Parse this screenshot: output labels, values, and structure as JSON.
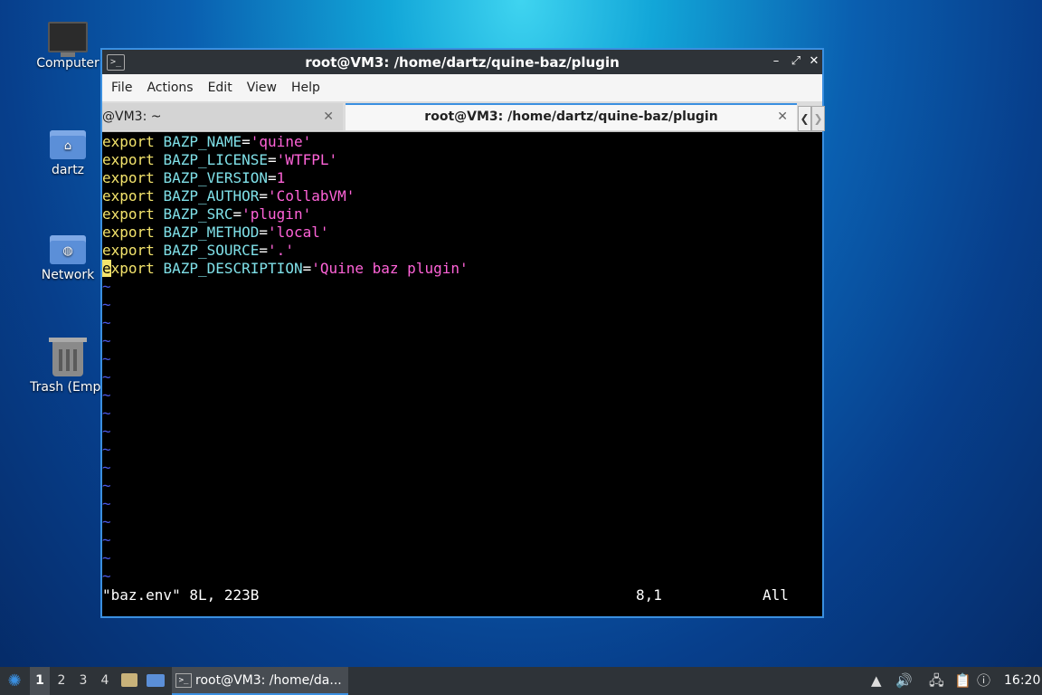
{
  "desktop": {
    "icons": [
      {
        "label": "Computer",
        "icon": "computer-icon"
      },
      {
        "label": "dartz",
        "icon": "home-folder-icon"
      },
      {
        "label": "Network",
        "icon": "network-folder-icon"
      },
      {
        "label": "Trash (Empt",
        "icon": "trash-icon"
      }
    ]
  },
  "window": {
    "title": "root@VM3: /home/dartz/quine-baz/plugin",
    "menu": [
      "File",
      "Actions",
      "Edit",
      "View",
      "Help"
    ],
    "tabs": [
      {
        "label": "@VM3: ~"
      },
      {
        "label": "root@VM3: /home/dartz/quine-baz/plugin"
      }
    ],
    "editor": {
      "lines": [
        {
          "var": "BAZP_NAME",
          "value": "'quine'"
        },
        {
          "var": "BAZP_LICENSE",
          "value": "'WTFPL'"
        },
        {
          "var": "BAZP_VERSION",
          "value": "1"
        },
        {
          "var": "BAZP_AUTHOR",
          "value": "'CollabVM'"
        },
        {
          "var": "BAZP_SRC",
          "value": "'plugin'"
        },
        {
          "var": "BAZP_METHOD",
          "value": "'local'"
        },
        {
          "var": "BAZP_SOURCE",
          "value": "'.'"
        },
        {
          "var": "BAZP_DESCRIPTION",
          "value": "'Quine baz plugin'"
        }
      ],
      "keyword": "export",
      "tilde": "~",
      "status_file": "\"baz.env\" 8L, 223B",
      "status_pos": "8,1",
      "status_scroll": "All"
    }
  },
  "taskbar": {
    "workspaces": [
      "1",
      "2",
      "3",
      "4"
    ],
    "task_label": "root@VM3: /home/da...",
    "clock": "16:20"
  },
  "colors": {
    "accent": "#3a8fe0",
    "keyword": "#f4e46c",
    "variable": "#7fe0e8",
    "string": "#ff63d8",
    "tilde": "#4a5ae8"
  }
}
